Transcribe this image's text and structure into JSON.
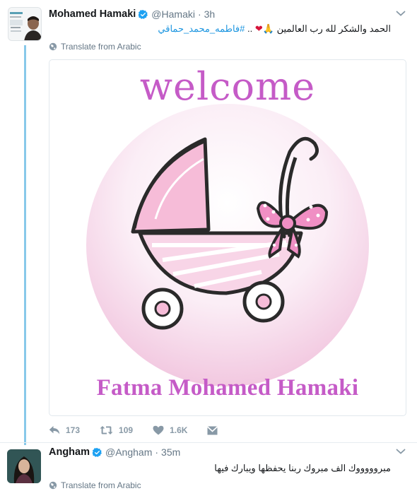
{
  "tweets": [
    {
      "fullname": "Mohamed Hamaki",
      "handle": "@Hamaki",
      "separator": "·",
      "time": "3h",
      "text_main": "الحمد والشكر لله رب العالمين",
      "text_tail": "..",
      "hashtag": "#فاطمه_محمد_حماقي",
      "translate": "Translate from Arabic",
      "media": {
        "welcome": "welcome",
        "baby_name": "Fatma Mohamed Hamaki"
      },
      "actions": {
        "replies": "173",
        "retweets": "109",
        "likes": "1.6K"
      }
    },
    {
      "fullname": "Angham",
      "handle": "@Angham",
      "separator": "·",
      "time": "35m",
      "text_main": "مبروووووك الف مبروك ربنا يحفظها ويبارك فيها",
      "translate": "Translate from Arabic"
    }
  ],
  "colors": {
    "link": "#1b95e0",
    "muted": "#657786",
    "thread_line": "#88c9ea",
    "pink_text": "#c55bc7",
    "heart": "#d6133a"
  },
  "icons": [
    "verified-badge-icon",
    "caret-down-icon",
    "globe-icon",
    "reply-icon",
    "retweet-icon",
    "like-icon",
    "direct-message-icon",
    "praying-hands-emoji",
    "red-heart-emoji"
  ]
}
